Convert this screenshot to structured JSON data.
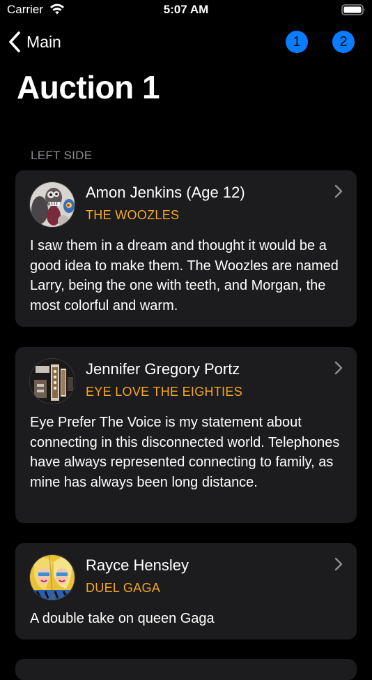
{
  "status_bar": {
    "carrier": "Carrier",
    "time": "5:07 AM",
    "icons": [
      "wifi-icon",
      "battery-icon"
    ]
  },
  "nav": {
    "back_label": "Main",
    "page_buttons": [
      "1",
      "2"
    ],
    "accent_color": "#0a7cff"
  },
  "page_title": "Auction 1",
  "section_header": "LEFT SIDE",
  "colors": {
    "background": "#000000",
    "card": "#1c1c1e",
    "title_accent": "#f5a623",
    "secondary_text": "#8e8e93"
  },
  "entries": [
    {
      "artist": "Amon Jenkins (Age 12)",
      "title": "THE WOOZLES",
      "description": "I saw them in a dream and thought it would be a good idea to make them. The Woozles are named Larry, being the one with teeth, and Morgan, the most colorful and warm.",
      "avatar": "artwork-thumbnail"
    },
    {
      "artist": "Jennifer Gregory Portz",
      "title": "EYE LOVE THE EIGHTIES",
      "description": "Eye Prefer The Voice is my statement about connecting in this disconnected world. Telephones have always represented connecting to family, as mine has always been long distance.",
      "avatar": "artwork-thumbnail"
    },
    {
      "artist": "Rayce Hensley",
      "title": "DUEL GAGA",
      "description": "A double take on queen Gaga",
      "avatar": "artwork-thumbnail"
    }
  ]
}
